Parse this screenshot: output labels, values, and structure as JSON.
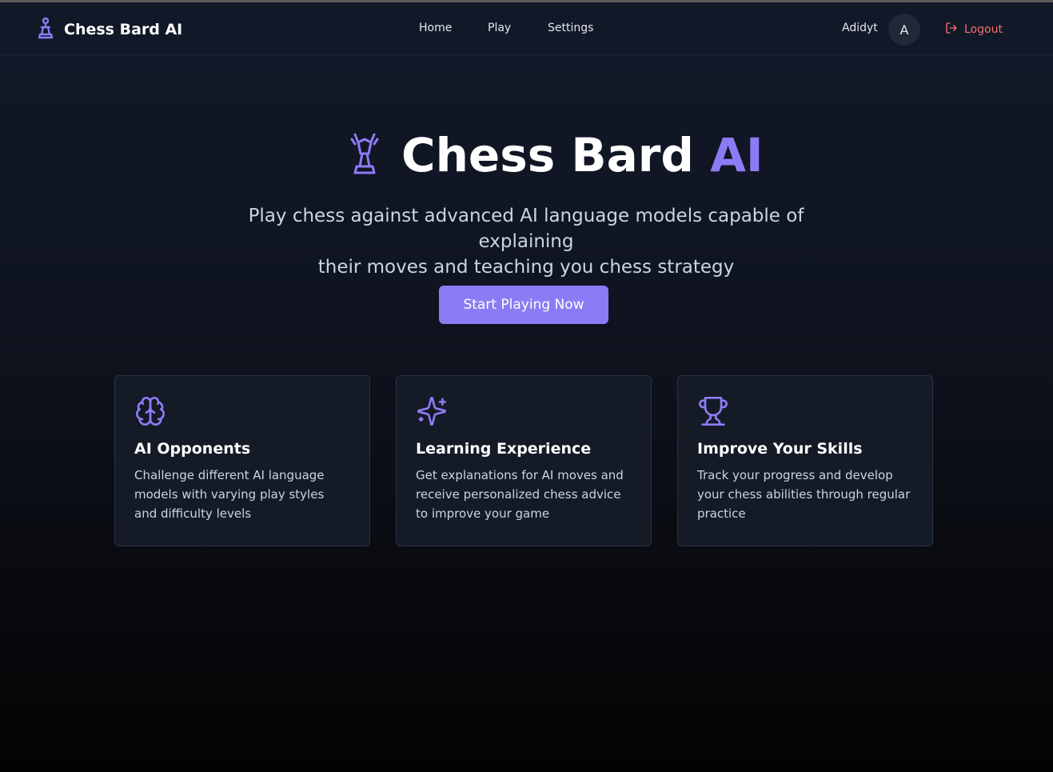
{
  "header": {
    "brand": "Chess Bard AI",
    "nav": [
      "Home",
      "Play",
      "Settings"
    ],
    "user_name": "Adidyt",
    "avatar_letter": "A",
    "logout_label": "Logout"
  },
  "hero": {
    "title_main": "Chess Bard ",
    "title_accent": "AI",
    "subtitle_line1": "Play chess against advanced AI language models capable of explaining",
    "subtitle_line2": "their moves and teaching you chess strategy",
    "cta_label": "Start Playing Now"
  },
  "features": [
    {
      "icon": "brain-icon",
      "title": "AI Opponents",
      "text": "Challenge different AI language models with varying play styles and difficulty levels"
    },
    {
      "icon": "sparkles-icon",
      "title": "Learning Experience",
      "text": "Get explanations for AI moves and receive personalized chess advice to improve your game"
    },
    {
      "icon": "trophy-icon",
      "title": "Improve Your Skills",
      "text": "Track your progress and develop your chess abilities through regular practice"
    }
  ],
  "colors": {
    "accent": "#8b7cf6",
    "logout": "#f87171",
    "background": "#111827",
    "card": "#141a26"
  }
}
